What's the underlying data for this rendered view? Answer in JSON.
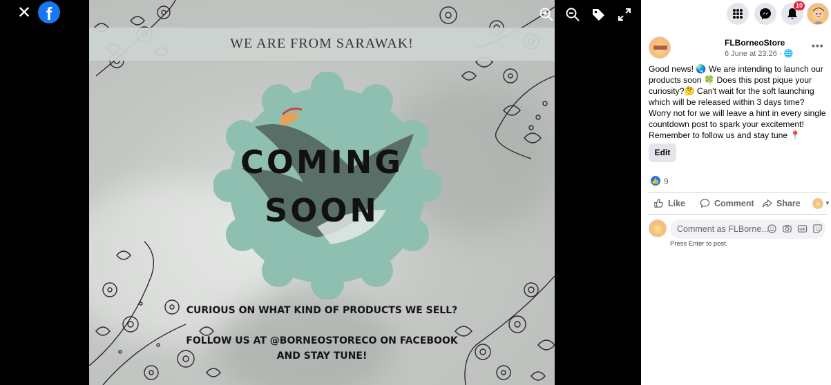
{
  "viewer": {
    "close_icon": "close-icon",
    "logo_icon": "facebook-logo-icon",
    "logo_letter": "f",
    "tools": [
      "zoom-in-icon",
      "zoom-out-icon",
      "tag-icon",
      "fullscreen-icon"
    ]
  },
  "photo": {
    "banner": "WE ARE FROM SARAWAK!",
    "headline_1": "COMING",
    "headline_2": "SOON",
    "line_1": "CURIOUS ON WHAT KIND OF PRODUCTS WE SELL?",
    "line_2": "FOLLOW US AT @BORNEOSTORECO ON FACEBOOK",
    "line_3": "AND STAY TUNE!",
    "badge_color": "#8fbfb0"
  },
  "topbar": {
    "icons": [
      "menu-grid-icon",
      "messenger-icon",
      "notifications-icon",
      "profile-avatar"
    ],
    "notification_count": "10"
  },
  "post": {
    "page_name": "FLBorneoStore",
    "time": "6 June at 23:26 · 🌐",
    "text": "Good news! 🌏 We are intending to launch our products soon 🍀 Does this post pique your curiosity?🤔 Can't wait for the soft launching which will be released within 3 days time? Worry not for we will leave a hint in every single countdown post to spark your excitement! Remember to follow us and stay tune 📍",
    "edit_label": "Edit",
    "like_count": "9",
    "actions": {
      "like": "Like",
      "comment": "Comment",
      "share": "Share"
    },
    "comment_placeholder": "Comment as FLBorne...",
    "press_enter": "Press Enter to post.",
    "accent_color": "#1877f2"
  }
}
